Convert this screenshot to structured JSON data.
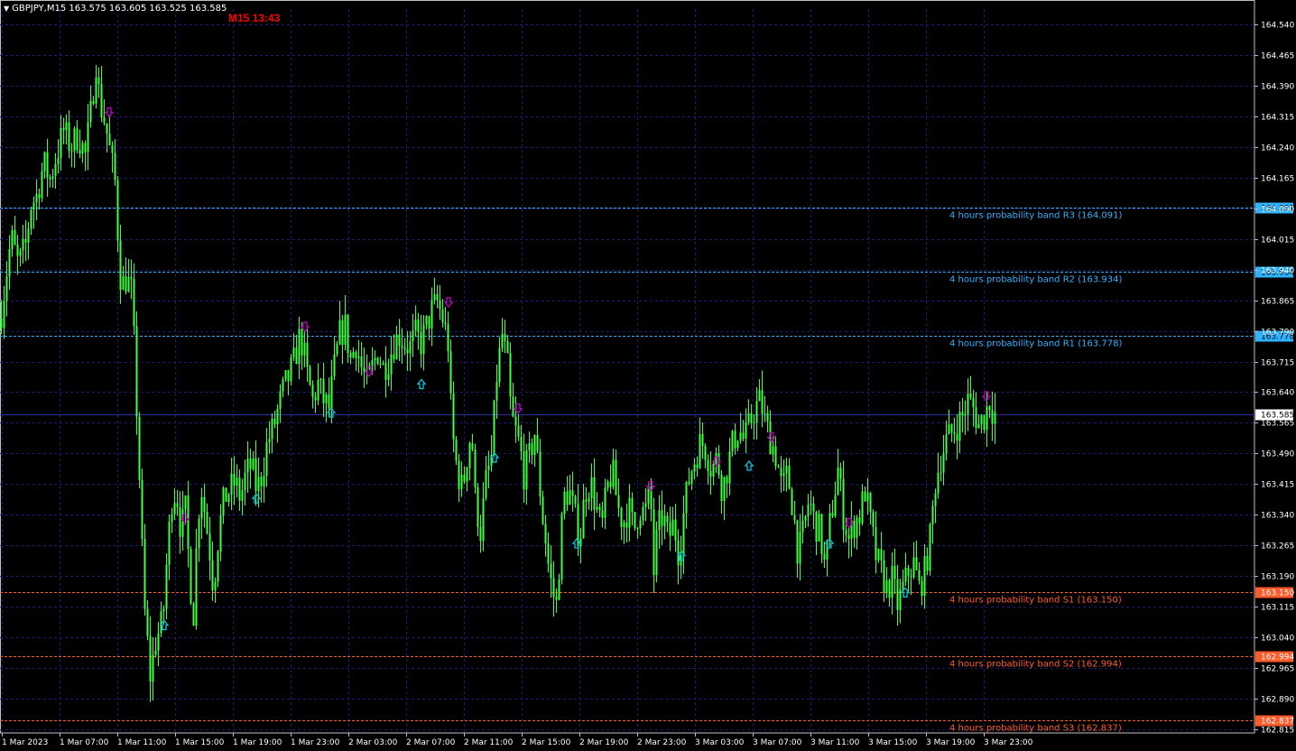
{
  "header": {
    "symbol_info": "GBPJPY,M15  163.575 163.605 163.525 163.585",
    "timer": "M15 13:43"
  },
  "colors": {
    "background": "#000000",
    "grid": "#1a1a6e",
    "candle": "#40ff40",
    "resistance": "#2db3ff",
    "support": "#ff5a2a",
    "arrow_down": "#c000c0",
    "arrow_up": "#00c8e0",
    "axis_text": "#ffffff",
    "timer": "#ff0000"
  },
  "chart_data": {
    "type": "candlestick",
    "ylim": [
      162.815,
      164.54
    ],
    "y_ticks": [
      "164.540",
      "164.465",
      "164.390",
      "164.315",
      "164.240",
      "164.165",
      "164.090",
      "164.015",
      "163.940",
      "163.865",
      "163.790",
      "163.715",
      "163.640",
      "163.565",
      "163.490",
      "163.415",
      "163.340",
      "163.265",
      "163.190",
      "163.115",
      "163.040",
      "162.965",
      "162.890",
      "162.815"
    ],
    "x_ticks": [
      "1 Mar 2023",
      "1 Mar 07:00",
      "1 Mar 11:00",
      "1 Mar 15:00",
      "1 Mar 19:00",
      "1 Mar 23:00",
      "2 Mar 03:00",
      "2 Mar 07:00",
      "2 Mar 11:00",
      "2 Mar 15:00",
      "2 Mar 19:00",
      "2 Mar 23:00",
      "3 Mar 03:00",
      "3 Mar 07:00",
      "3 Mar 11:00",
      "3 Mar 15:00",
      "3 Mar 19:00",
      "3 Mar 23:00"
    ],
    "current_price": "163.585",
    "bands": [
      {
        "label": "4 hours probability band R3 (164.091)",
        "value": 164.091,
        "tag": "164.091",
        "kind": "resistance"
      },
      {
        "label": "4 hours probability band R2 (163.934)",
        "value": 163.934,
        "tag": "163.934",
        "kind": "resistance"
      },
      {
        "label": "4 hours probability band R1 (163.778)",
        "value": 163.778,
        "tag": "163.778",
        "kind": "resistance"
      },
      {
        "label": "4 hours probability band S1 (163.150)",
        "value": 163.15,
        "tag": "163.150",
        "kind": "support"
      },
      {
        "label": "4 hours probability band S2 (162.994)",
        "value": 162.994,
        "tag": "162.994",
        "kind": "support"
      },
      {
        "label": "4 hours probability band S3 (162.837)",
        "value": 162.837,
        "tag": "162.837",
        "kind": "support"
      }
    ],
    "path": [
      [
        0,
        163.82
      ],
      [
        6,
        163.92
      ],
      [
        12,
        164.02
      ],
      [
        20,
        163.95
      ],
      [
        28,
        164.0
      ],
      [
        34,
        164.1
      ],
      [
        40,
        164.12
      ],
      [
        48,
        164.2
      ],
      [
        55,
        164.16
      ],
      [
        62,
        164.22
      ],
      [
        70,
        164.28
      ],
      [
        78,
        164.24
      ],
      [
        86,
        164.27
      ],
      [
        94,
        164.22
      ],
      [
        100,
        164.32
      ],
      [
        106,
        164.45
      ],
      [
        110,
        164.35
      ],
      [
        116,
        164.3
      ],
      [
        122,
        164.22
      ],
      [
        128,
        164.14
      ],
      [
        131,
        163.98
      ],
      [
        134,
        163.9
      ],
      [
        140,
        163.92
      ],
      [
        146,
        163.88
      ],
      [
        150,
        163.65
      ],
      [
        153,
        163.5
      ],
      [
        156,
        163.3
      ],
      [
        160,
        163.1
      ],
      [
        164,
        163.0
      ],
      [
        167,
        162.92
      ],
      [
        170,
        163.02
      ],
      [
        175,
        163.05
      ],
      [
        180,
        163.08
      ],
      [
        185,
        163.25
      ],
      [
        190,
        163.38
      ],
      [
        195,
        163.4
      ],
      [
        200,
        163.3
      ],
      [
        205,
        163.35
      ],
      [
        210,
        163.18
      ],
      [
        214,
        163.1
      ],
      [
        218,
        163.3
      ],
      [
        222,
        163.42
      ],
      [
        228,
        163.32
      ],
      [
        232,
        163.25
      ],
      [
        236,
        163.16
      ],
      [
        242,
        163.3
      ],
      [
        248,
        163.38
      ],
      [
        254,
        163.4
      ],
      [
        260,
        163.42
      ],
      [
        266,
        163.38
      ],
      [
        272,
        163.44
      ],
      [
        278,
        163.46
      ],
      [
        284,
        163.4
      ],
      [
        290,
        163.44
      ],
      [
        296,
        163.52
      ],
      [
        302,
        163.55
      ],
      [
        308,
        163.6
      ],
      [
        314,
        163.65
      ],
      [
        320,
        163.68
      ],
      [
        326,
        163.72
      ],
      [
        332,
        163.78
      ],
      [
        336,
        163.74
      ],
      [
        340,
        163.68
      ],
      [
        346,
        163.62
      ],
      [
        352,
        163.66
      ],
      [
        358,
        163.62
      ],
      [
        364,
        163.6
      ],
      [
        370,
        163.7
      ],
      [
        376,
        163.78
      ],
      [
        382,
        163.8
      ],
      [
        388,
        163.72
      ],
      [
        394,
        163.76
      ],
      [
        400,
        163.7
      ],
      [
        406,
        163.66
      ],
      [
        412,
        163.7
      ],
      [
        418,
        163.74
      ],
      [
        424,
        163.7
      ],
      [
        430,
        163.72
      ],
      [
        436,
        163.76
      ],
      [
        442,
        163.78
      ],
      [
        448,
        163.76
      ],
      [
        454,
        163.75
      ],
      [
        460,
        163.78
      ],
      [
        466,
        163.76
      ],
      [
        472,
        163.8
      ],
      [
        478,
        163.84
      ],
      [
        484,
        163.86
      ],
      [
        490,
        163.82
      ],
      [
        496,
        163.76
      ],
      [
        500,
        163.55
      ],
      [
        506,
        163.45
      ],
      [
        512,
        163.4
      ],
      [
        518,
        163.5
      ],
      [
        522,
        163.55
      ],
      [
        526,
        163.38
      ],
      [
        532,
        163.3
      ],
      [
        538,
        163.42
      ],
      [
        544,
        163.48
      ],
      [
        550,
        163.68
      ],
      [
        556,
        163.78
      ],
      [
        562,
        163.7
      ],
      [
        566,
        163.58
      ],
      [
        570,
        163.55
      ],
      [
        576,
        163.5
      ],
      [
        580,
        163.44
      ],
      [
        586,
        163.48
      ],
      [
        592,
        163.54
      ],
      [
        596,
        163.45
      ],
      [
        600,
        163.35
      ],
      [
        604,
        163.28
      ],
      [
        608,
        163.2
      ],
      [
        612,
        163.15
      ],
      [
        616,
        163.12
      ],
      [
        620,
        163.25
      ],
      [
        624,
        163.38
      ],
      [
        630,
        163.4
      ],
      [
        636,
        163.34
      ],
      [
        642,
        163.28
      ],
      [
        648,
        163.4
      ],
      [
        654,
        163.42
      ],
      [
        660,
        163.36
      ],
      [
        666,
        163.3
      ],
      [
        672,
        163.4
      ],
      [
        678,
        163.45
      ],
      [
        684,
        163.36
      ],
      [
        690,
        163.32
      ],
      [
        696,
        163.36
      ],
      [
        702,
        163.3
      ],
      [
        708,
        163.36
      ],
      [
        714,
        163.34
      ],
      [
        720,
        163.4
      ],
      [
        724,
        163.2
      ],
      [
        728,
        163.3
      ],
      [
        734,
        163.34
      ],
      [
        740,
        163.28
      ],
      [
        746,
        163.32
      ],
      [
        752,
        163.24
      ],
      [
        758,
        163.36
      ],
      [
        764,
        163.44
      ],
      [
        770,
        163.48
      ],
      [
        776,
        163.52
      ],
      [
        782,
        163.5
      ],
      [
        788,
        163.45
      ],
      [
        794,
        163.48
      ],
      [
        800,
        163.4
      ],
      [
        806,
        163.46
      ],
      [
        812,
        163.52
      ],
      [
        818,
        163.55
      ],
      [
        824,
        163.52
      ],
      [
        830,
        163.56
      ],
      [
        836,
        163.6
      ],
      [
        842,
        163.62
      ],
      [
        848,
        163.56
      ],
      [
        854,
        163.52
      ],
      [
        860,
        163.48
      ],
      [
        866,
        163.4
      ],
      [
        872,
        163.44
      ],
      [
        878,
        163.36
      ],
      [
        884,
        163.24
      ],
      [
        890,
        163.3
      ],
      [
        896,
        163.38
      ],
      [
        902,
        163.32
      ],
      [
        908,
        163.3
      ],
      [
        914,
        163.2
      ],
      [
        918,
        163.3
      ],
      [
        922,
        163.36
      ],
      [
        928,
        163.45
      ],
      [
        934,
        163.34
      ],
      [
        940,
        163.28
      ],
      [
        946,
        163.32
      ],
      [
        952,
        163.34
      ],
      [
        958,
        163.4
      ],
      [
        964,
        163.32
      ],
      [
        970,
        163.24
      ],
      [
        976,
        163.2
      ],
      [
        982,
        163.16
      ],
      [
        988,
        163.18
      ],
      [
        994,
        163.12
      ],
      [
        1000,
        163.16
      ],
      [
        1006,
        163.2
      ],
      [
        1012,
        163.22
      ],
      [
        1018,
        163.16
      ],
      [
        1024,
        163.2
      ],
      [
        1030,
        163.28
      ],
      [
        1036,
        163.42
      ],
      [
        1042,
        163.48
      ],
      [
        1048,
        163.52
      ],
      [
        1054,
        163.54
      ],
      [
        1060,
        163.56
      ],
      [
        1066,
        163.58
      ],
      [
        1072,
        163.62
      ],
      [
        1078,
        163.6
      ],
      [
        1084,
        163.56
      ],
      [
        1090,
        163.58
      ],
      [
        1096,
        163.62
      ],
      [
        1100,
        163.59
      ],
      [
        1104,
        163.585
      ]
    ],
    "arrows": [
      {
        "dir": "down",
        "x": 121,
        "y": 164.325
      },
      {
        "dir": "up",
        "x": 182,
        "y": 163.07
      },
      {
        "dir": "down",
        "x": 205,
        "y": 163.33
      },
      {
        "dir": "up",
        "x": 284,
        "y": 163.38
      },
      {
        "dir": "down",
        "x": 338,
        "y": 163.8
      },
      {
        "dir": "up",
        "x": 367,
        "y": 163.59
      },
      {
        "dir": "down",
        "x": 409,
        "y": 163.69
      },
      {
        "dir": "up",
        "x": 467,
        "y": 163.66
      },
      {
        "dir": "down",
        "x": 497,
        "y": 163.86
      },
      {
        "dir": "up",
        "x": 548,
        "y": 163.48
      },
      {
        "dir": "down",
        "x": 574,
        "y": 163.6
      },
      {
        "dir": "up",
        "x": 639,
        "y": 163.27
      },
      {
        "dir": "down",
        "x": 721,
        "y": 163.41
      },
      {
        "dir": "up",
        "x": 755,
        "y": 163.24
      },
      {
        "dir": "down",
        "x": 794,
        "y": 163.47
      },
      {
        "dir": "up",
        "x": 830,
        "y": 163.46
      },
      {
        "dir": "down",
        "x": 855,
        "y": 163.53
      },
      {
        "dir": "up",
        "x": 919,
        "y": 163.27
      },
      {
        "dir": "down",
        "x": 941,
        "y": 163.32
      },
      {
        "dir": "up",
        "x": 1003,
        "y": 163.15
      },
      {
        "dir": "down",
        "x": 1093,
        "y": 163.63
      }
    ]
  }
}
